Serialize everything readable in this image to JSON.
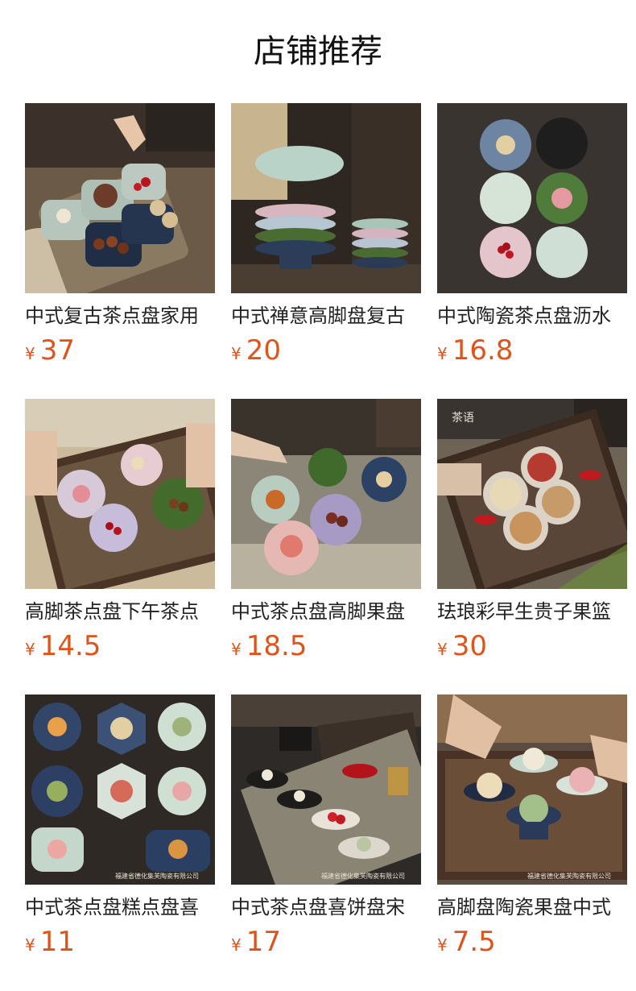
{
  "page_title": "店铺推荐",
  "currency_symbol": "¥",
  "products": [
    {
      "name": "中式复古茶点盘家用",
      "price": "37",
      "image": "tea-snack-plates-tray-photo"
    },
    {
      "name": "中式禅意高脚盘复古",
      "price": "20",
      "image": "stacked-pedestal-plates-photo"
    },
    {
      "name": "中式陶瓷茶点盘沥水",
      "price": "16.8",
      "image": "flower-dishes-grid-photo"
    },
    {
      "name": "高脚茶点盘下午茶点",
      "price": "14.5",
      "image": "flower-plates-rattan-tray-photo"
    },
    {
      "name": "中式茶点盘高脚果盘",
      "price": "18.5",
      "image": "flower-bowls-snacks-photo"
    },
    {
      "name": "珐琅彩早生贵子果篮",
      "price": "30",
      "image": "enamel-bowls-nuts-tray-photo"
    },
    {
      "name": "中式茶点盘糕点盘喜",
      "price": "11",
      "image": "shaped-dishes-mooncakes-photo"
    },
    {
      "name": "中式茶点盘喜饼盘宋",
      "price": "17",
      "image": "pedestal-dishes-table-runner-photo"
    },
    {
      "name": "高脚盘陶瓷果盘中式",
      "price": "7.5",
      "image": "pedestal-plates-wood-tray-photo"
    }
  ],
  "watermarks": {
    "watermark_7": "福建省德化集芙陶瓷有限公司",
    "watermark_8": "福建省德化集芙陶瓷有限公司",
    "watermark_9": "福建省德化集芙陶瓷有限公司",
    "logo_6": "茶语"
  },
  "colors": {
    "price": "#e0531a",
    "title": "#111111",
    "name": "#222222"
  }
}
